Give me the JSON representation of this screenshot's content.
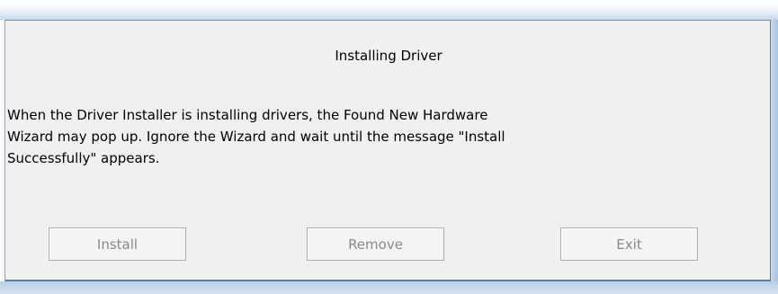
{
  "dialog": {
    "title": "Installing Driver",
    "message_lines": [
      "When the Driver Installer is installing drivers, the Found New Hardware",
      "Wizard may pop up. Ignore the Wizard and wait until the message \"Install",
      "Successfully\" appears."
    ],
    "buttons": {
      "install": "Install",
      "remove": "Remove",
      "exit": "Exit"
    },
    "buttons_enabled": false
  },
  "colors": {
    "dialog_background": "#f0f0f0",
    "disabled_text": "#8a8a8a",
    "frame_accent": "#c6d8ec"
  }
}
